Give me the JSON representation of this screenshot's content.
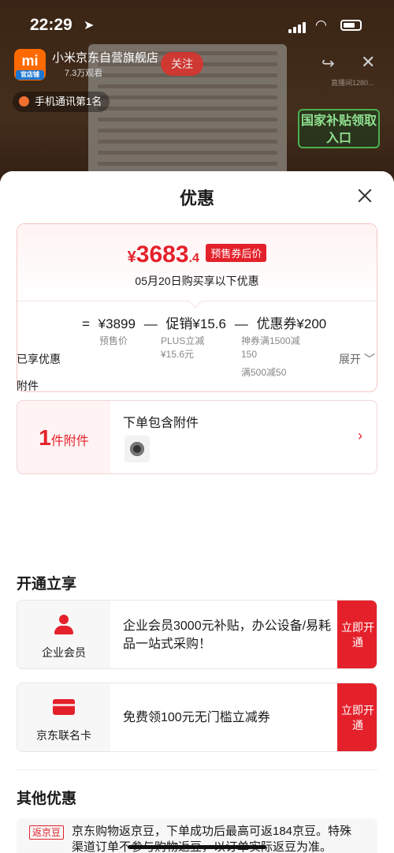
{
  "status_bar": {
    "time": "22:29",
    "location_icon": "location-arrow-icon"
  },
  "live": {
    "shop_logo_text": "mi",
    "shop_logo_badge": "官店铺",
    "shop_name": "小米京东自营旗舰店",
    "viewers": "7.3万观看",
    "follow_label": "关注",
    "room_id": "直播间1280...",
    "tag_label": "手机通讯第1名",
    "subsidy_banner": "国家补贴领取入口"
  },
  "sheet": {
    "title": "优惠",
    "price": {
      "yen": "¥",
      "integer": "3683",
      "decimal": ".4",
      "badge": "预售券后价",
      "subtitle": "05月20日购买享以下优惠"
    },
    "formula": {
      "equals": "=",
      "base_price": "¥3899",
      "minus1": "—",
      "promo": "促销¥15.6",
      "minus2": "—",
      "coupon": "优惠券¥200",
      "base_desc": "预售价",
      "promo_desc_1": "PLUS立减",
      "promo_desc_2": "¥15.6元",
      "coupon_desc_1": "神券满1500减",
      "coupon_desc_2": "150",
      "coupon_desc_3": "满500减50"
    },
    "enjoyed_label": "已享优惠",
    "expand_label": "展开 ﹀",
    "accessory": {
      "section_label": "附件",
      "count": "1",
      "count_unit": "件附件",
      "title": "下单包含附件",
      "arrow": "›"
    },
    "open_section": {
      "title": "开通立享",
      "cards": [
        {
          "label": "企业会员",
          "text": "企业会员3000元补贴，办公设备/易耗品一站式采购！",
          "button": "立即开通"
        },
        {
          "label": "京东联名卡",
          "text": "免费领100元无门槛立减券",
          "button": "立即开通"
        }
      ]
    },
    "other": {
      "title": "其他优惠",
      "badge": "返京豆",
      "text": "京东购物返京豆，下单成功后最高可返184京豆。特殊渠道订单不参与购物返豆，以订单实际返豆为准。"
    }
  },
  "colors": {
    "accent": "#e4212b",
    "subsidy_green": "#4caf50"
  }
}
